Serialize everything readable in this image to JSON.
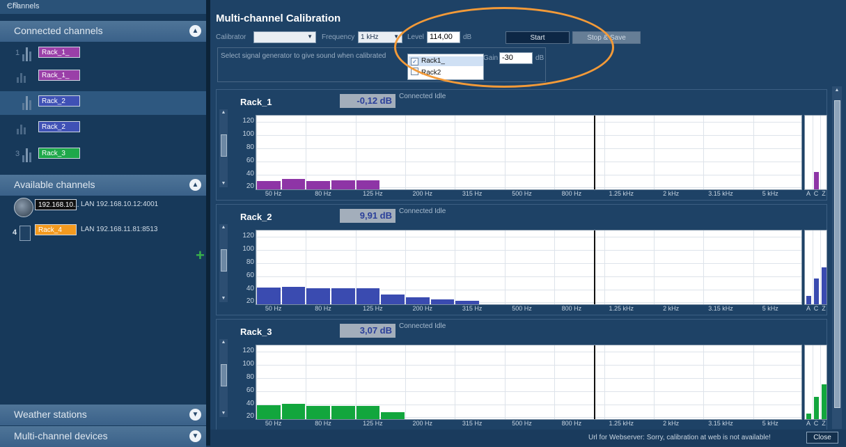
{
  "channels_panel": {
    "title": "Channels",
    "pin_icon": "pin-icon",
    "connected_header": "Connected channels",
    "connected": [
      {
        "num": "1",
        "label": "Rack_1_",
        "color": "#9a3fa8"
      },
      {
        "num": "",
        "label": "Rack_1_",
        "color": "#9a3fa8"
      },
      {
        "num": "",
        "label": "Rack_2",
        "color": "#3f51b5"
      },
      {
        "num": "",
        "label": "Rack_2",
        "color": "#3f51b5"
      },
      {
        "num": "3",
        "label": "Rack_3",
        "color": "#1ea84a"
      }
    ],
    "available_header": "Available channels",
    "available": [
      {
        "num": "",
        "label": "192.168.10...",
        "address": "LAN 192.168.10.12:4001",
        "color": "#111111"
      },
      {
        "num": "4",
        "label": "Rack_4",
        "address": "LAN 192.168.11.81:8513",
        "color": "#f39a1f"
      }
    ],
    "weather_header": "Weather stations",
    "devices_header": "Multi-channel devices"
  },
  "calibration": {
    "title": "Multi-channel Calibration",
    "calibrator_label": "Calibrator",
    "calibrator_value": "",
    "frequency_label": "Frequency",
    "frequency_value": "1 kHz",
    "level_label": "Level",
    "level_value": "114,00",
    "level_unit": "dB",
    "start_label": "Start",
    "stop_label": "Stop & Save",
    "generator_text": "Select signal generator to give sound when calibrated",
    "generator_options": [
      {
        "label": "Rack1_",
        "checked": true
      },
      {
        "label": "Rack2",
        "checked": false
      }
    ],
    "gain_label": "Gain",
    "gain_value": "-30",
    "gain_unit": "dB"
  },
  "x_axis_labels": [
    "50 Hz",
    "80 Hz",
    "125 Hz",
    "200 Hz",
    "315 Hz",
    "500 Hz",
    "800 Hz",
    "1.25 kHz",
    "2 kHz",
    "3.15 kHz",
    "5 kHz"
  ],
  "y_axis_labels": [
    "120",
    "100",
    "80",
    "60",
    "40",
    "20"
  ],
  "weighting_labels": [
    "A",
    "C",
    "Z"
  ],
  "racks": [
    {
      "name": "Rack_1",
      "level": "-0,12 dB",
      "status": "Connected  Idle",
      "color": "#8e35a6",
      "bands": [
        28,
        31,
        28,
        29,
        29
      ],
      "weights": [
        0,
        42,
        0
      ]
    },
    {
      "name": "Rack_2",
      "level": "9,91 dB",
      "status": "Connected  Idle",
      "color": "#3a4bb0",
      "bands": [
        41,
        42,
        40,
        40,
        40,
        30,
        26,
        22,
        20
      ],
      "weights": [
        28,
        54,
        71
      ]
    },
    {
      "name": "Rack_3",
      "level": "3,07 dB",
      "status": "Connected  Idle",
      "color": "#12a63d",
      "bands": [
        36,
        38,
        35,
        35,
        35,
        26
      ],
      "weights": [
        24,
        49,
        68
      ]
    }
  ],
  "footer": {
    "message": "Url for Webserver: Sorry, calibration at web is not available!",
    "close_label": "Close"
  }
}
